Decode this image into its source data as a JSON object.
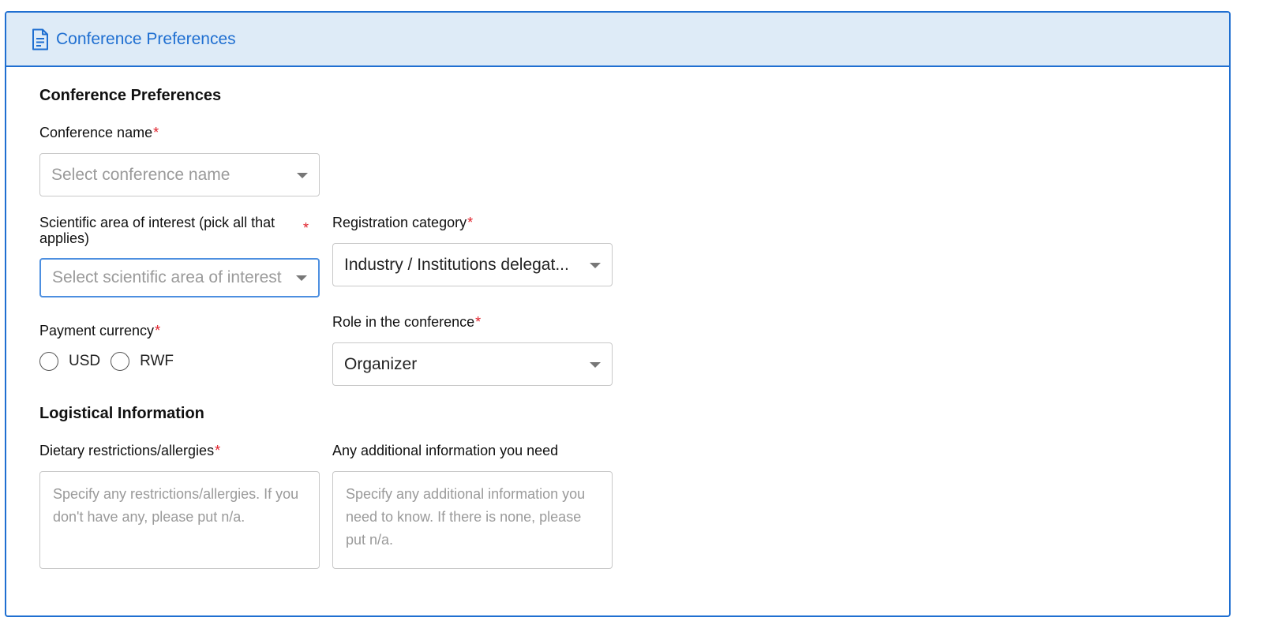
{
  "header": {
    "title": "Conference Preferences",
    "icon": "document-icon",
    "accent_color": "#1f6fd1",
    "background_color": "#deebf7"
  },
  "sections": {
    "conference_preferences": "Conference Preferences",
    "logistical_information": "Logistical Information"
  },
  "required_marker": "*",
  "fields": {
    "conference_name": {
      "label": "Conference name",
      "placeholder": "Select conference name"
    },
    "scientific_area": {
      "label": "Scientific area of interest (pick all that applies)",
      "placeholder": "Select scientific area of interest"
    },
    "registration_category": {
      "label": "Registration category",
      "value": "Industry / Institutions delegat..."
    },
    "payment_currency": {
      "label": "Payment currency",
      "options": [
        "USD",
        "RWF"
      ]
    },
    "role": {
      "label": "Role in the conference",
      "value": "Organizer"
    },
    "dietary": {
      "label": "Dietary restrictions/allergies",
      "placeholder": "Specify any restrictions/allergies. If you don't have any, please put n/a."
    },
    "additional_info": {
      "label": "Any additional information you need",
      "placeholder": "Specify any additional information you need to know. If there is none, please put n/a."
    }
  }
}
